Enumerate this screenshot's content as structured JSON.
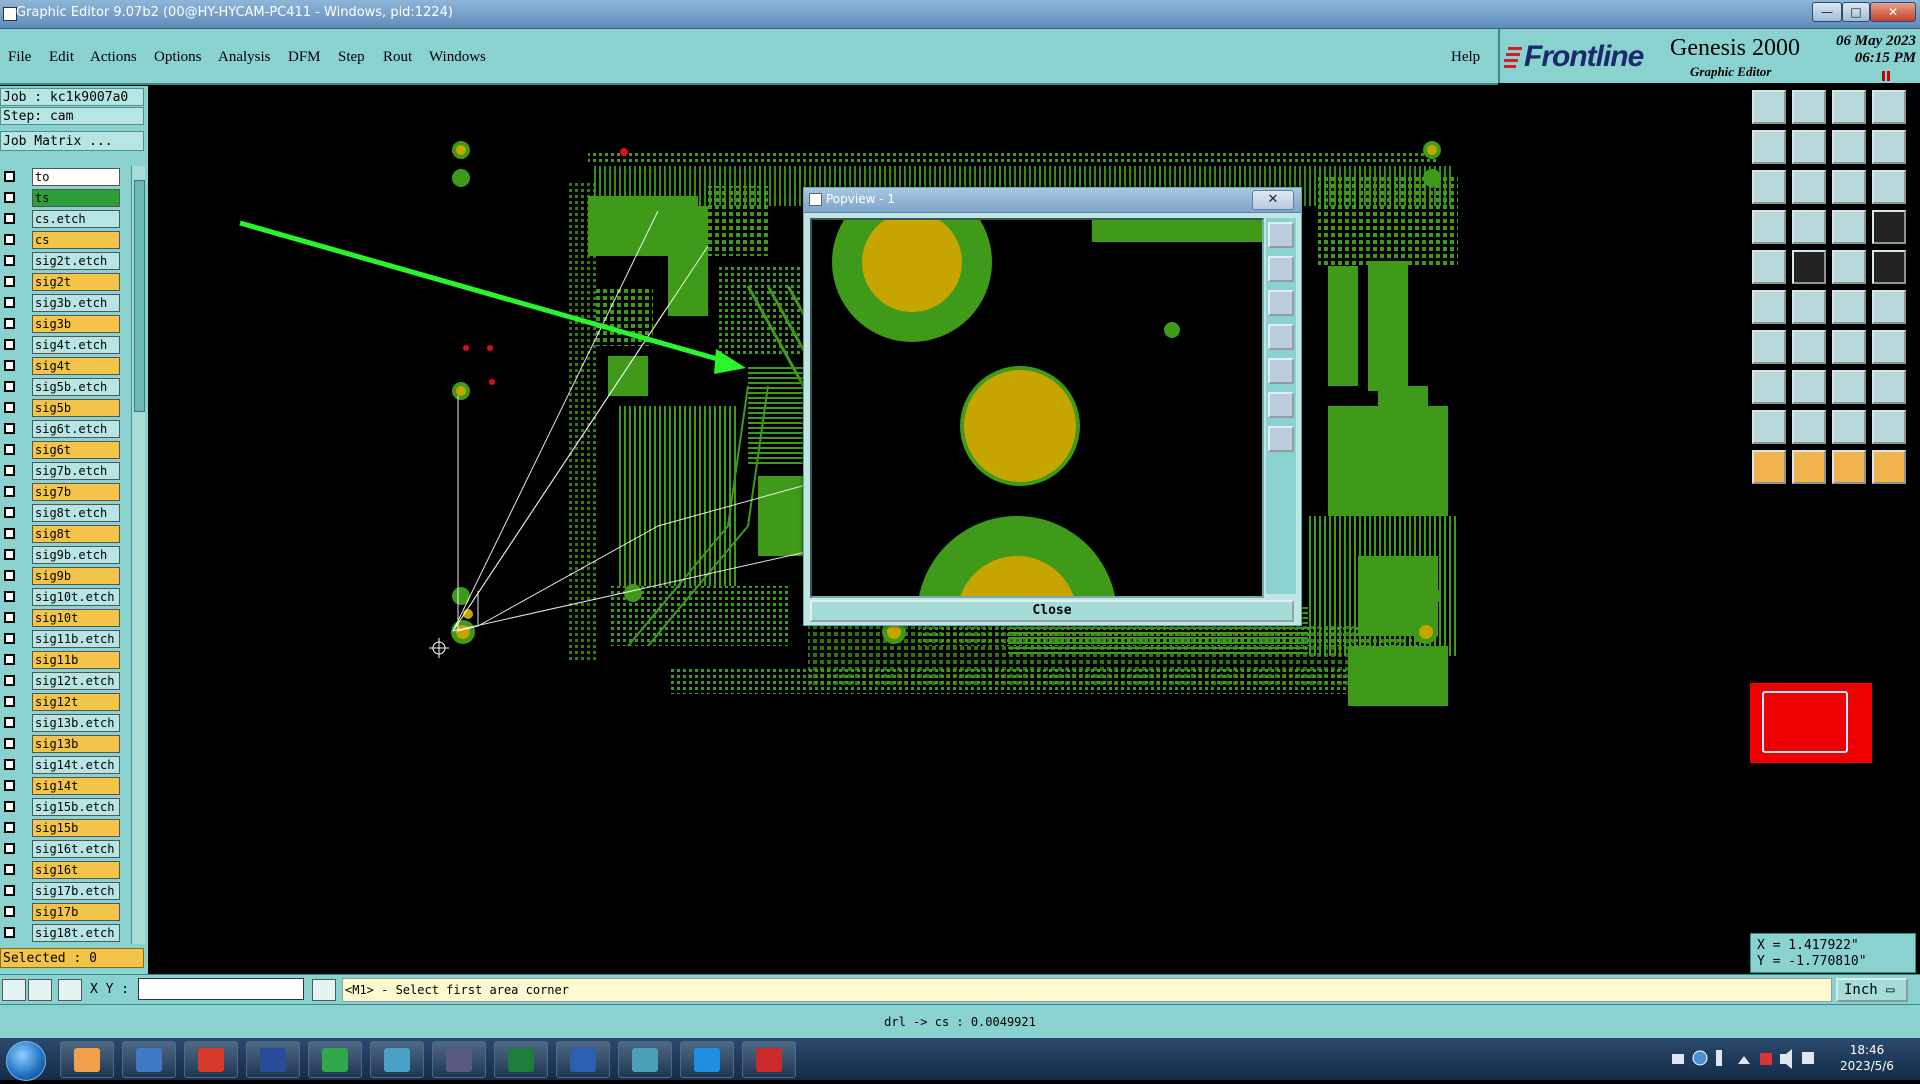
{
  "window": {
    "title": "Graphic Editor 9.07b2 (00@HY-HYCAM-PC411 - Windows, pid:1224)",
    "minimize": "—",
    "maximize": "□",
    "close": "✕"
  },
  "menu": {
    "items": [
      "File",
      "Edit",
      "Actions",
      "Options",
      "Analysis",
      "DFM",
      "Step",
      "Rout",
      "Windows"
    ],
    "help": "Help"
  },
  "brand": {
    "logo": "Frontline",
    "product": "Genesis 2000",
    "subtitle": "Graphic Editor",
    "date": "06 May 2023",
    "time": "06:15 PM"
  },
  "left_panel": {
    "job": "Job : kc1k9007a0",
    "step": "Step: cam",
    "job_matrix": "Job Matrix ...",
    "selected": "Selected : 0",
    "layers": [
      {
        "name": "to",
        "color": "#ffffff"
      },
      {
        "name": "ts",
        "color": "#2e9e3a"
      },
      {
        "name": "cs.etch",
        "color": "#b5e6e3"
      },
      {
        "name": "cs",
        "color": "#f4c44a"
      },
      {
        "name": "sig2t.etch",
        "color": "#b5e6e3"
      },
      {
        "name": "sig2t",
        "color": "#f4c44a"
      },
      {
        "name": "sig3b.etch",
        "color": "#b5e6e3"
      },
      {
        "name": "sig3b",
        "color": "#f4c44a"
      },
      {
        "name": "sig4t.etch",
        "color": "#b5e6e3"
      },
      {
        "name": "sig4t",
        "color": "#f4c44a"
      },
      {
        "name": "sig5b.etch",
        "color": "#b5e6e3"
      },
      {
        "name": "sig5b",
        "color": "#f4c44a"
      },
      {
        "name": "sig6t.etch",
        "color": "#b5e6e3"
      },
      {
        "name": "sig6t",
        "color": "#f4c44a"
      },
      {
        "name": "sig7b.etch",
        "color": "#b5e6e3"
      },
      {
        "name": "sig7b",
        "color": "#f4c44a"
      },
      {
        "name": "sig8t.etch",
        "color": "#b5e6e3"
      },
      {
        "name": "sig8t",
        "color": "#f4c44a"
      },
      {
        "name": "sig9b.etch",
        "color": "#b5e6e3"
      },
      {
        "name": "sig9b",
        "color": "#f4c44a"
      },
      {
        "name": "sig10t.etch",
        "color": "#b5e6e3"
      },
      {
        "name": "sig10t",
        "color": "#f4c44a"
      },
      {
        "name": "sig11b.etch",
        "color": "#b5e6e3"
      },
      {
        "name": "sig11b",
        "color": "#f4c44a"
      },
      {
        "name": "sig12t.etch",
        "color": "#b5e6e3"
      },
      {
        "name": "sig12t",
        "color": "#f4c44a"
      },
      {
        "name": "sig13b.etch",
        "color": "#b5e6e3"
      },
      {
        "name": "sig13b",
        "color": "#f4c44a"
      },
      {
        "name": "sig14t.etch",
        "color": "#b5e6e3"
      },
      {
        "name": "sig14t",
        "color": "#f4c44a"
      },
      {
        "name": "sig15b.etch",
        "color": "#b5e6e3"
      },
      {
        "name": "sig15b",
        "color": "#f4c44a"
      },
      {
        "name": "sig16t.etch",
        "color": "#b5e6e3"
      },
      {
        "name": "sig16t",
        "color": "#f4c44a"
      },
      {
        "name": "sig17b.etch",
        "color": "#b5e6e3"
      },
      {
        "name": "sig17b",
        "color": "#f4c44a"
      },
      {
        "name": "sig18t.etch",
        "color": "#b5e6e3"
      }
    ]
  },
  "popview": {
    "title": "Popview - 1",
    "close_x": "✕",
    "close_button": "Close"
  },
  "right_panel": {
    "x": "X = 1.417922\"",
    "y": "Y = -1.770810\""
  },
  "command": {
    "xy_label": "X Y :",
    "xy_value": "",
    "prompt": "<M1> - Select first area corner",
    "unit": "Inch ▭"
  },
  "status": {
    "text": "drl -> cs : 0.0049921"
  },
  "taskbar": {
    "apps": [
      "shell-icon",
      "notepad-icon",
      "genesis-icon",
      "save-icon",
      "editor-icon",
      "eye-icon",
      "excel-x-icon",
      "excel-icon",
      "word-icon",
      "eye2-icon",
      "arrow-icon",
      "pdf-icon"
    ],
    "time": "18:46",
    "date": "2023/5/6"
  },
  "colors": {
    "panel": "#8ad2cf",
    "copper": "#3f9a1a",
    "pad": "#c7a500",
    "arrow": "#2af52a"
  }
}
